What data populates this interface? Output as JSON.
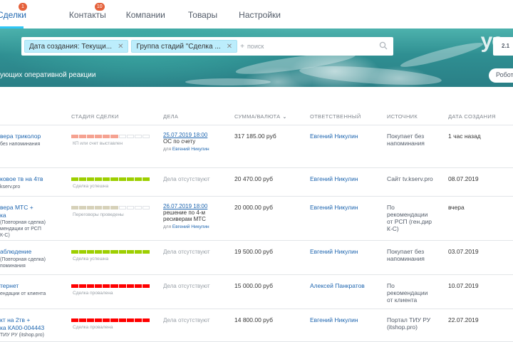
{
  "nav": {
    "items": [
      {
        "label": "Сделки",
        "badge": "1"
      },
      {
        "label": "Контакты",
        "badge": "10"
      },
      {
        "label": "Компании",
        "badge": ""
      },
      {
        "label": "Товары",
        "badge": ""
      },
      {
        "label": "Настройки",
        "badge": ""
      }
    ]
  },
  "filter": {
    "chips": [
      "Дата создания: Текущи...",
      "Группа стадий \"Сделка ..."
    ],
    "search_placeholder": "поиск",
    "search_plus": "+"
  },
  "header": {
    "logo": "ye",
    "side_button": "2.1",
    "title": "ующих оперативной реакции",
    "robots_button": "Робот"
  },
  "columns": {
    "stage": "СТАДИЯ СДЕЛКИ",
    "activities": "ДЕЛА",
    "sum": "СУММА/ВАЛЮТА",
    "responsible": "ОТВЕТСТВЕННЫЙ",
    "source": "ИСТОЧНИК",
    "created": "ДАТА СОЗДАНИЯ"
  },
  "colors": {
    "stage_success": "#9dcf00",
    "stage_fail": "#ff0000",
    "stage_meeting": "#d6d1b9",
    "stage_invoice": "#f5a291",
    "accent": "#2fc6f6",
    "link": "#2067b0"
  },
  "rows": [
    {
      "title": "верa триколор",
      "sub": "без напоминания",
      "stage_label": "КП или счет выставлен",
      "stage_filled": 6,
      "stage_color": "#f5a291",
      "activity_date": "25.07.2019 18:00",
      "activity_text": "ОС по счету",
      "activity_for_prefix": "для",
      "activity_for": "Евгений Никулин",
      "activity_none": "",
      "sum": "317 185.00 руб",
      "responsible": "Евгений Никулин",
      "source": "Покупает без\nнапоминания",
      "created": "1 час назад"
    },
    {
      "title": "ковое тв на 4тв",
      "sub": "kserv.pro",
      "stage_label": "Сделка успешна",
      "stage_filled": 10,
      "stage_color": "#9dcf00",
      "activity_date": "",
      "activity_text": "",
      "activity_for_prefix": "",
      "activity_for": "",
      "activity_none": "Дела отсутствуют",
      "sum": "20 470.00 руб",
      "responsible": "Евгений Никулин",
      "source": "Сайт tv.kserv.pro",
      "created": "08.07.2019"
    },
    {
      "title": "вера МТС +\nка",
      "sub": "(Повторная сделка)\nмендации от РСП\nК-С)",
      "stage_label": "Переговоры проведены",
      "stage_filled": 6,
      "stage_color": "#d6d1b9",
      "activity_date": "26.07.2019 18:00",
      "activity_text": "решение по 4-м\nресиверам МТС",
      "activity_for_prefix": "для",
      "activity_for": "Евгений Никулин",
      "activity_none": "",
      "sum": "20 000.00 руб",
      "responsible": "Евгений Никулин",
      "source": "По\nрекомендации\nот РСП (ген.дир\nК-С)",
      "created": "вчера"
    },
    {
      "title": "аблюдение",
      "sub": "(Повторная сделка)\nпоминания",
      "stage_label": "Сделка успешна",
      "stage_filled": 10,
      "stage_color": "#9dcf00",
      "activity_date": "",
      "activity_text": "",
      "activity_for_prefix": "",
      "activity_for": "",
      "activity_none": "Дела отсутствуют",
      "sum": "19 500.00 руб",
      "responsible": "Евгений Никулин",
      "source": "Покупает без\nнапоминания",
      "created": "03.07.2019"
    },
    {
      "title": "тернет",
      "sub": "ендации от клиента",
      "stage_label": "Сделка провалена",
      "stage_filled": 10,
      "stage_color": "#ff0000",
      "activity_date": "",
      "activity_text": "",
      "activity_for_prefix": "",
      "activity_for": "",
      "activity_none": "Дела отсутствуют",
      "sum": "15 000.00 руб",
      "responsible": "Алексей Панкратов",
      "source": "По\nрекомендации\nот клиента",
      "created": "10.07.2019"
    },
    {
      "title": "кт на 2тв +\nка КА00-004443",
      "sub": "ТИУ РУ (itshop.pro)",
      "stage_label": "Сделка провалена",
      "stage_filled": 10,
      "stage_color": "#ff0000",
      "activity_date": "",
      "activity_text": "",
      "activity_for_prefix": "",
      "activity_for": "",
      "activity_none": "Дела отсутствуют",
      "sum": "14 800.00 руб",
      "responsible": "Евгений Никулин",
      "source": "Портал ТИУ РУ\n(itshop.pro)",
      "created": "22.07.2019"
    }
  ]
}
